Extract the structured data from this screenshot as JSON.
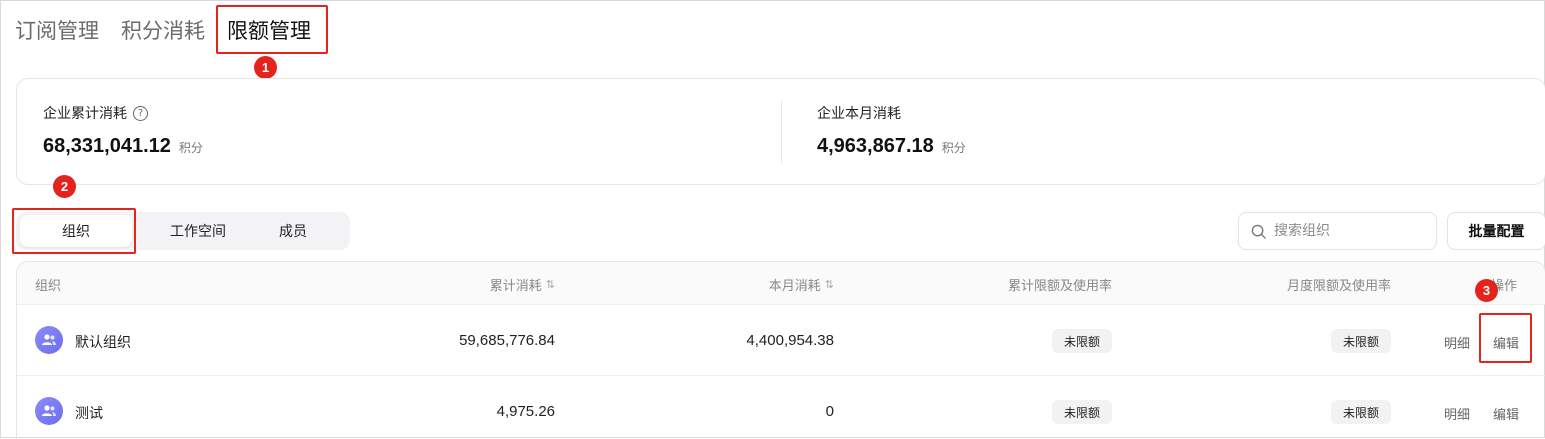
{
  "tabs": [
    {
      "label": "订阅管理",
      "active": false
    },
    {
      "label": "积分消耗",
      "active": false
    },
    {
      "label": "限额管理",
      "active": true
    }
  ],
  "markers": [
    "1",
    "2",
    "3"
  ],
  "stats": {
    "total": {
      "label": "企业累计消耗",
      "value": "68,331,041.12",
      "unit": "积分"
    },
    "month": {
      "label": "企业本月消耗",
      "value": "4,963,867.18",
      "unit": "积分"
    }
  },
  "segments": [
    {
      "label": "组织",
      "active": true
    },
    {
      "label": "工作空间",
      "active": false
    },
    {
      "label": "成员",
      "active": false
    }
  ],
  "search": {
    "placeholder": "搜索组织"
  },
  "batch_button": "批量配置",
  "table": {
    "columns": [
      "组织",
      "累计消耗",
      "本月消耗",
      "累计限额及使用率",
      "月度限额及使用率",
      "操作"
    ],
    "rows": [
      {
        "name": "默认组织",
        "total": "59,685,776.84",
        "month": "4,400,954.38",
        "total_limit": "未限额",
        "month_limit": "未限额",
        "detail": "明细",
        "edit": "编辑"
      },
      {
        "name": "测试",
        "total": "4,975.26",
        "month": "0",
        "total_limit": "未限额",
        "month_limit": "未限额",
        "detail": "明细",
        "edit": "编辑"
      }
    ]
  },
  "colors": {
    "highlight": "#e5231d",
    "avatar": "#7b7cf4"
  }
}
